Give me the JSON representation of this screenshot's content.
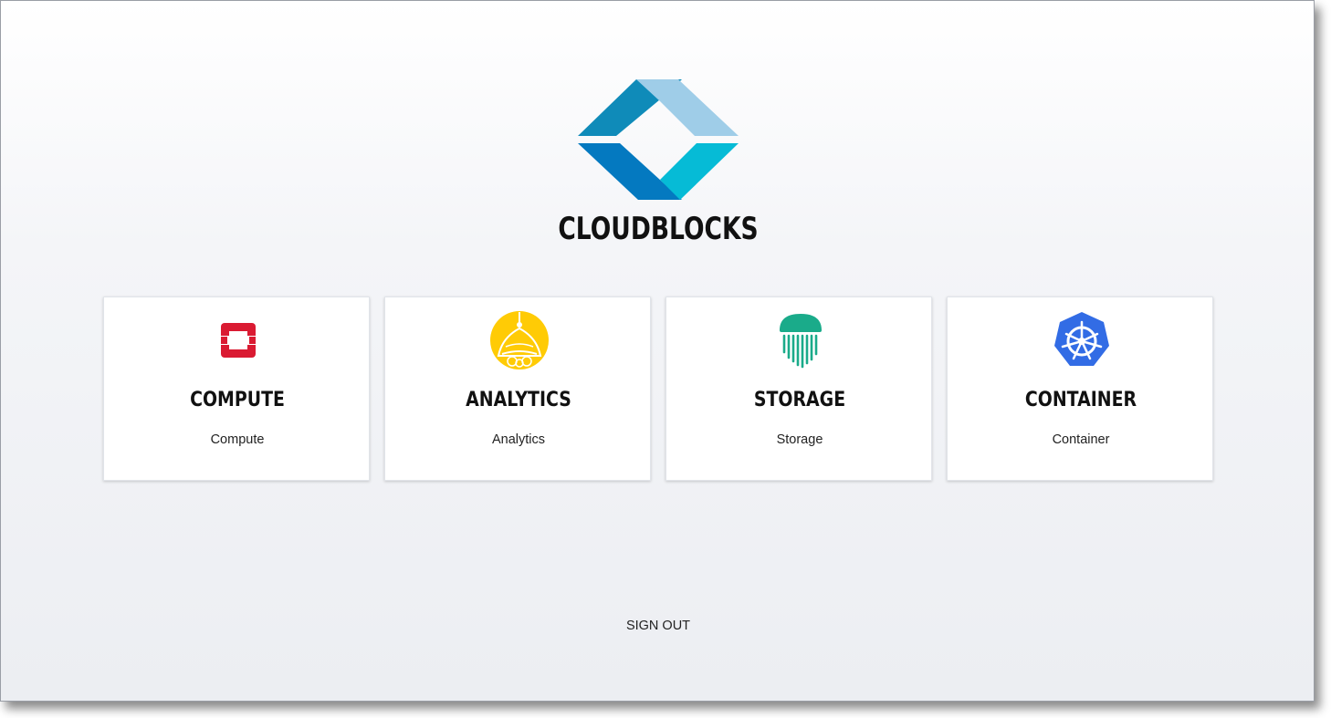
{
  "app": {
    "brand_name": "CLOUDBLOCKS",
    "logo_icon": "cloudblocks-diamond-logo",
    "colors": {
      "logo_dark_blue": "#0f8bb9",
      "logo_light_blue": "#9fcde8",
      "logo_deep_blue": "#0479c0",
      "logo_cyan": "#06bbd6"
    }
  },
  "services": [
    {
      "title": "COMPUTE",
      "description": "Compute",
      "icon": "openstack-icon",
      "color": "#da1a32"
    },
    {
      "title": "ANALYTICS",
      "description": "Analytics",
      "icon": "hadoop-dome-icon",
      "color": "#ffcb05"
    },
    {
      "title": "STORAGE",
      "description": "Storage",
      "icon": "jellyfish-icon",
      "color": "#1aab8a"
    },
    {
      "title": "CONTAINER",
      "description": "Container",
      "icon": "kubernetes-icon",
      "color": "#326ce5"
    }
  ],
  "footer": {
    "sign_out_label": "SIGN OUT"
  }
}
